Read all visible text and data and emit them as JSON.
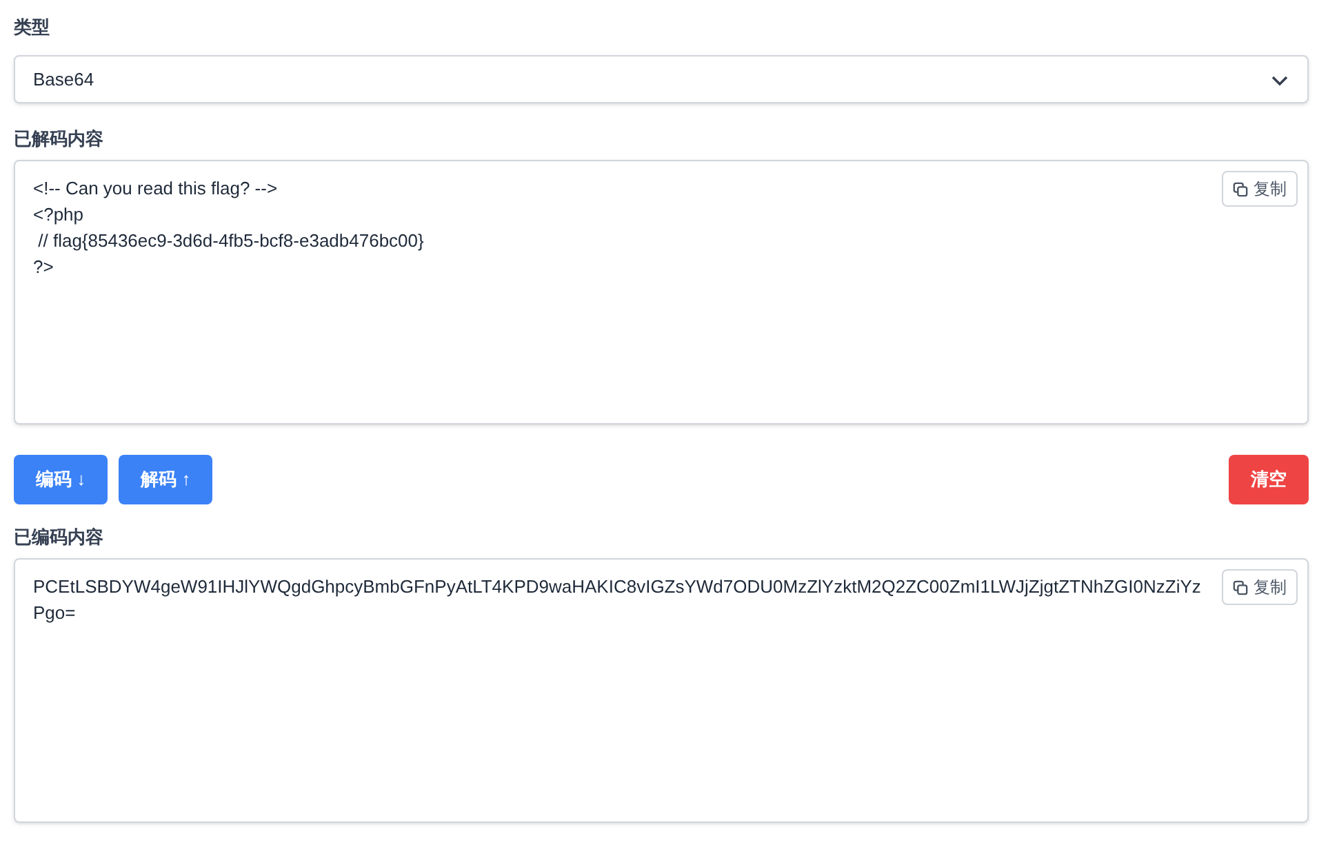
{
  "type_field": {
    "label": "类型",
    "value": "Base64"
  },
  "decoded": {
    "label": "已解码内容",
    "value": "<!-- Can you read this flag? -->\n<?php\n // flag{85436ec9-3d6d-4fb5-bcf8-e3adb476bc00}\n?>",
    "copy_button": "复制"
  },
  "buttons": [
    {
      "label": "编码 ↓",
      "kind": "primary"
    },
    {
      "label": "解码 ↑",
      "kind": "primary"
    },
    {
      "label": "清空",
      "kind": "danger"
    }
  ],
  "encoded": {
    "label": "已编码内容",
    "value": "PCEtLSBDYW4geW91IHJlYWQgdGhpcyBmbGFnPyAtLT4KPD9waHAKIC8vIGZsYWd7ODU0MzZlYzktM2Q2ZC00ZmI1LWJjZjgtZTNhZGI0NzZiYz\nPgo=",
    "copy_button": "复制"
  }
}
